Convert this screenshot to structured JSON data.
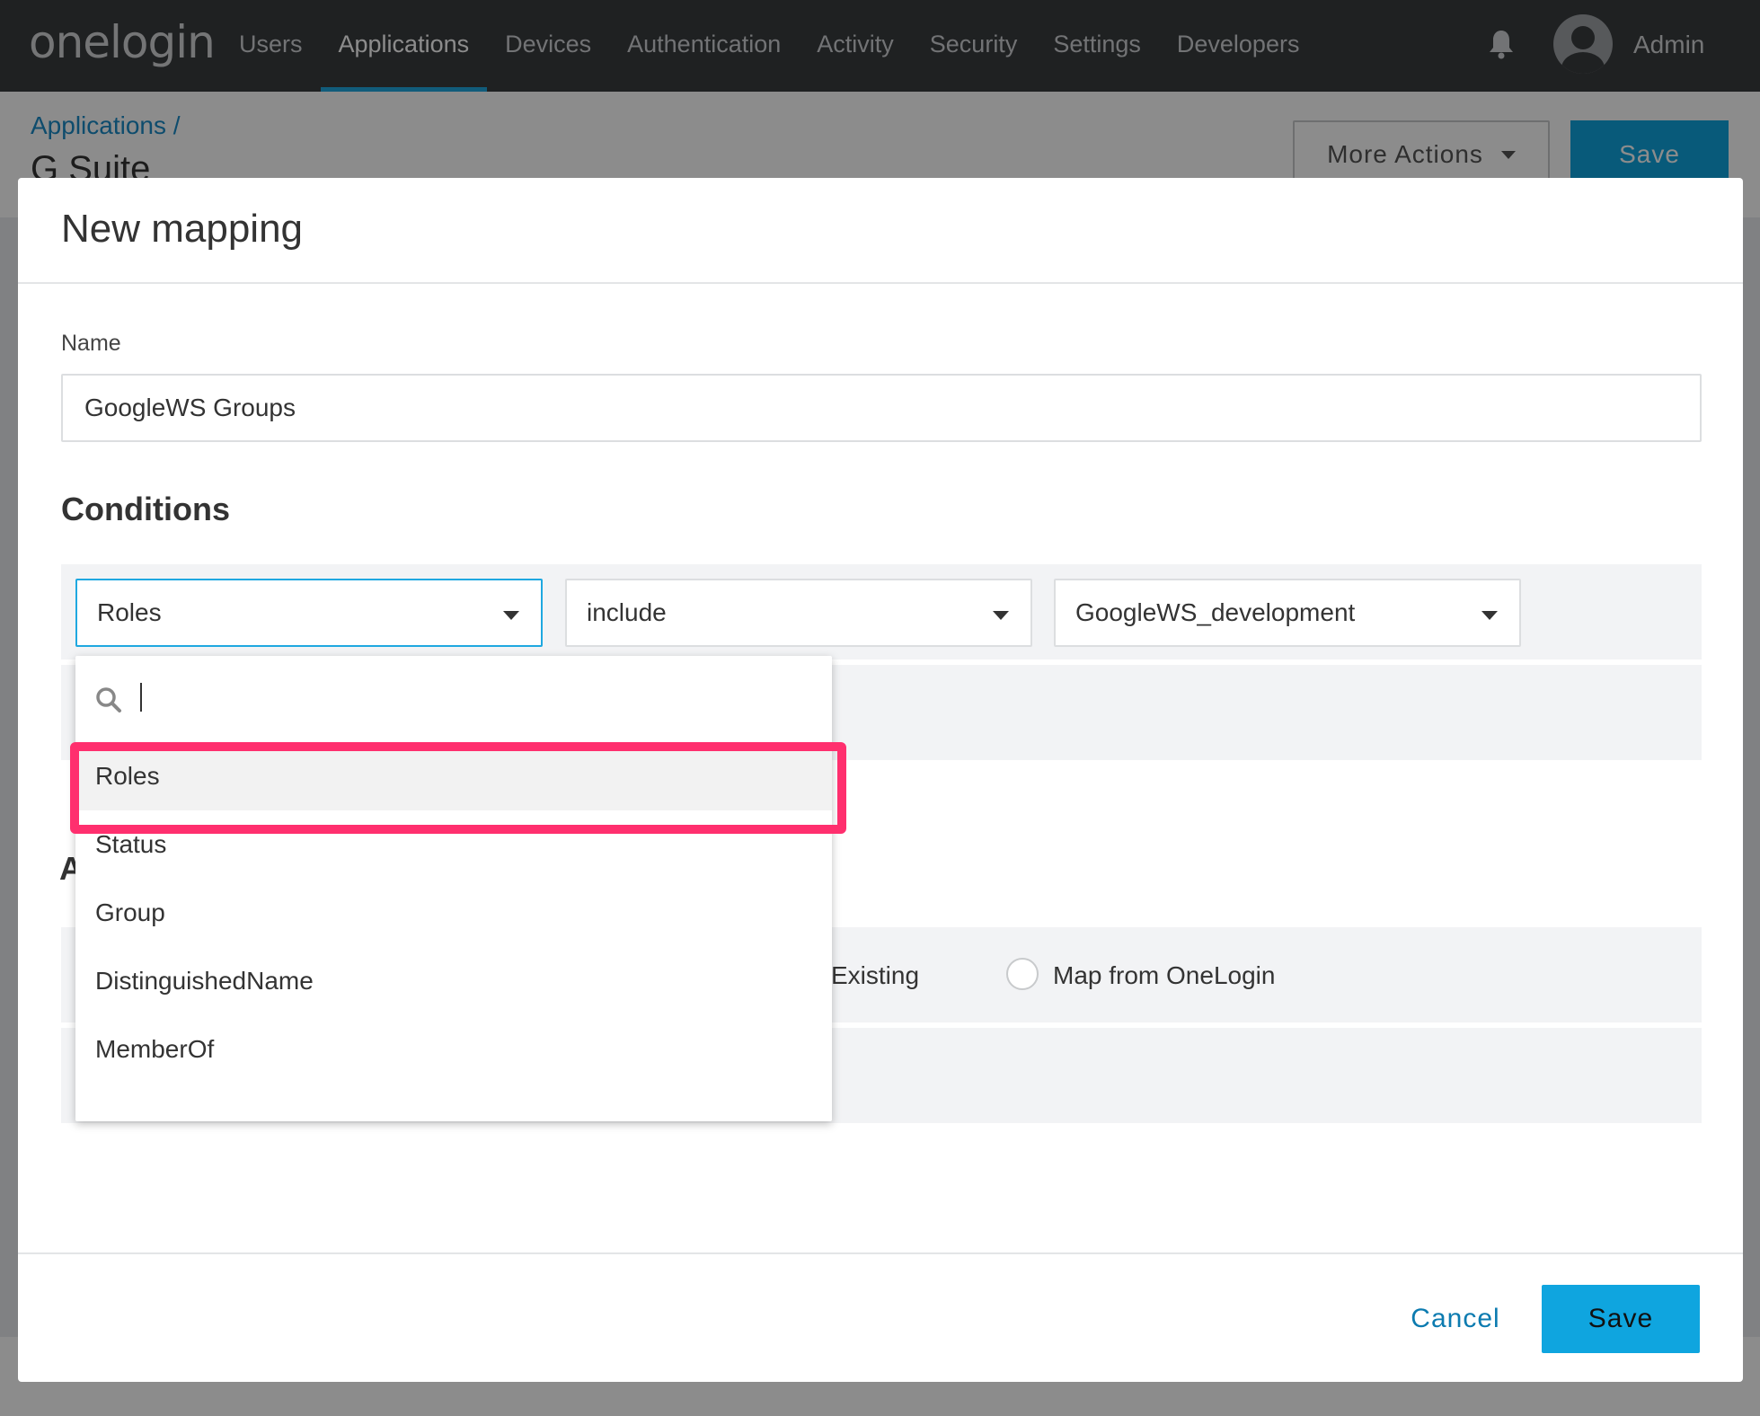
{
  "nav": {
    "logo": "onelogin",
    "items": [
      {
        "label": "Users",
        "active": false
      },
      {
        "label": "Applications",
        "active": true
      },
      {
        "label": "Devices",
        "active": false
      },
      {
        "label": "Authentication",
        "active": false
      },
      {
        "label": "Activity",
        "active": false
      },
      {
        "label": "Security",
        "active": false
      },
      {
        "label": "Settings",
        "active": false
      },
      {
        "label": "Developers",
        "active": false
      }
    ],
    "user_label": "Admin",
    "bell_icon": "bell-icon",
    "avatar_icon": "user-avatar-icon"
  },
  "page": {
    "breadcrumb": "Applications /",
    "title": "G Suite",
    "more_actions_label": "More Actions",
    "save_label": "Save"
  },
  "modal": {
    "title": "New mapping",
    "name_label": "Name",
    "name_value": "GoogleWS Groups",
    "conditions_heading": "Conditions",
    "condition": {
      "field": "Roles",
      "operator": "include",
      "value": "GoogleWS_development"
    },
    "actions_heading_partial": "A",
    "actions": {
      "existing_label": "Existing",
      "map_label": "Map from OneLogin"
    },
    "cancel_label": "Cancel",
    "save_label": "Save"
  },
  "dropdown": {
    "search_value": "",
    "search_icon": "search-icon",
    "options": [
      "Roles",
      "Status",
      "Group",
      "DistinguishedName",
      "MemberOf"
    ],
    "highlighted_option": "Roles"
  },
  "colors": {
    "nav_bg": "#3a3c3f",
    "accent": "#0fa5df",
    "focus": "#1fa8e0",
    "highlight": "#ff2f6e",
    "link": "#0c7bb0"
  }
}
